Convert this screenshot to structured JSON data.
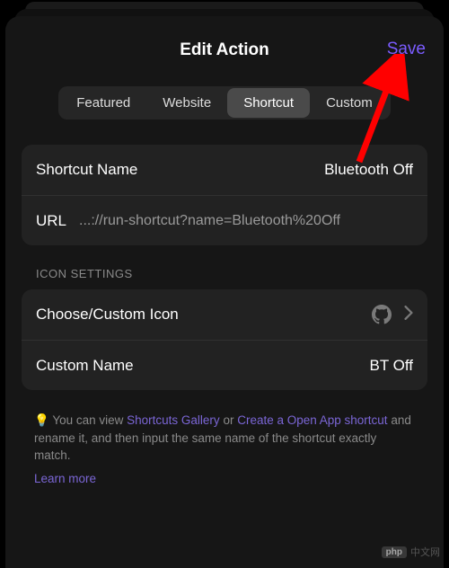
{
  "header": {
    "title": "Edit Action",
    "save_label": "Save"
  },
  "segments": {
    "featured": "Featured",
    "website": "Website",
    "shortcut": "Shortcut",
    "custom": "Custom"
  },
  "shortcut": {
    "name_label": "Shortcut Name",
    "name_value": "Bluetooth Off",
    "url_label": "URL",
    "url_value": "...://run-shortcut?name=Bluetooth%20Off"
  },
  "icon_section": {
    "header": "ICON SETTINGS",
    "choose_label": "Choose/Custom Icon",
    "custom_name_label": "Custom Name",
    "custom_name_value": "BT Off"
  },
  "tip": {
    "bulb": "💡",
    "pre": "You can view ",
    "link1": "Shortcuts Gallery",
    "mid": " or ",
    "link2": "Create a Open App shortcut",
    "post": " and rename it, and then input the same name of the shortcut exactly match.",
    "learn_more": "Learn more"
  },
  "watermark": {
    "badge": "php",
    "text": "中文网"
  }
}
